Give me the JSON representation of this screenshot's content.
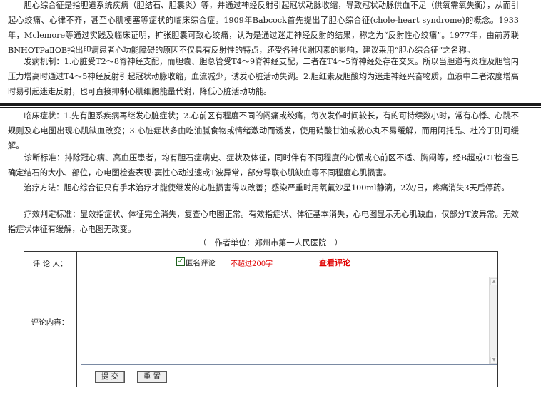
{
  "article": {
    "p1": "　　胆心综合征是指胆道系统疾病（胆结石、胆囊炎）等，并通过神经反射引起冠状动脉收缩，导致冠状动脉供血不足（供氧需氧失衡），从而引起心绞痛、心律不齐，甚至心肌梗塞等症状的临床综合症。1909年Babcock首先提出了胆心综合征(chole-heart syndrome)的概念。1933年，Mclemore等通过实践及临床证明，扩张胆囊可致心绞痛，认为是通过迷走神经反射的结果，称之为“反射性心绞痛”。1977年，由前苏联BNHOTPaⅡOB指出胆病患者心功能障碍的原因不仅具有反射性的特点，还受各种代谢因素的影响，建议采用“胆心综合征”之名称。",
    "p2": "　　发病机制：1.心脏受T2～8脊神经支配，而胆囊、胆总管受T4～9脊神经支配，二者在T4～5脊神经处存在交叉。所以当胆道有炎症及胆管内压力增高时通过T4～5神经反射引起冠状动脉收缩，血流减少，诱发心脏活动失调。2.胆红素及胆酸均为迷走神经兴奋物质，血液中二者浓度增高时易引起迷走反射，也可直接抑制心肌细胞能量代谢，降低心脏活动功能。",
    "p3": "　　临床症状：1.先有胆系疾病再继发心脏症状；2.心前区有程度不同的闷痛或绞痛，每次发作时间较长，有的可持续数小时，常有心悸、心跳不规则及心电图出现心肌缺血改变；3.心脏症状多由吃油腻食物或情绪激动而诱发，使用硝酸甘油或救心丸不易缓解，而用阿托品、杜冷丁则可缓解。",
    "p4": "　　诊断标准：排除冠心病、高血压患者，均有胆石症病史、症状及体征，同时伴有不同程度的心慌或心前区不适、胸闷等，经B超或CT检查已确定结石的大小、部位，心电图检查表现:窦性心动过速或T波异常，部分导联心肌缺血等不同程度心肌损害。",
    "p5": "　　治疗方法：胆心综合征只有手术治疗才能使继发的心脏损害得以改善；感染严重时用氧氟沙星100ml静滴，2次/日，疼痛消失3天后停药。",
    "p6": "　　疗效判定标准：显效指症状、体征完全消失，复查心电图正常。有效指症状、体征基本消失，心电图显示无心肌缺血，仅部分T波异常。无效指症状体征有缓解，心电图无改变。",
    "author": "（　作者单位：郑州市第一人民医院　）"
  },
  "comment_form": {
    "commenter_label": "评 论 人：",
    "commenter_value": "",
    "anonymous_checked": true,
    "anonymous_label": "匿名评论",
    "limit_note": "不超过200字",
    "view_comments_label": "查看评论",
    "content_label": "评论内容：",
    "content_value": "",
    "submit_label": "提 交",
    "reset_label": "重 置"
  },
  "icons": {
    "checkbox": "check-icon",
    "scroll_up": "up-arrow-icon",
    "scroll_down": "down-arrow-icon"
  },
  "colors": {
    "warning_red": "#e00000",
    "checkbox_green": "#1a7a1a"
  }
}
